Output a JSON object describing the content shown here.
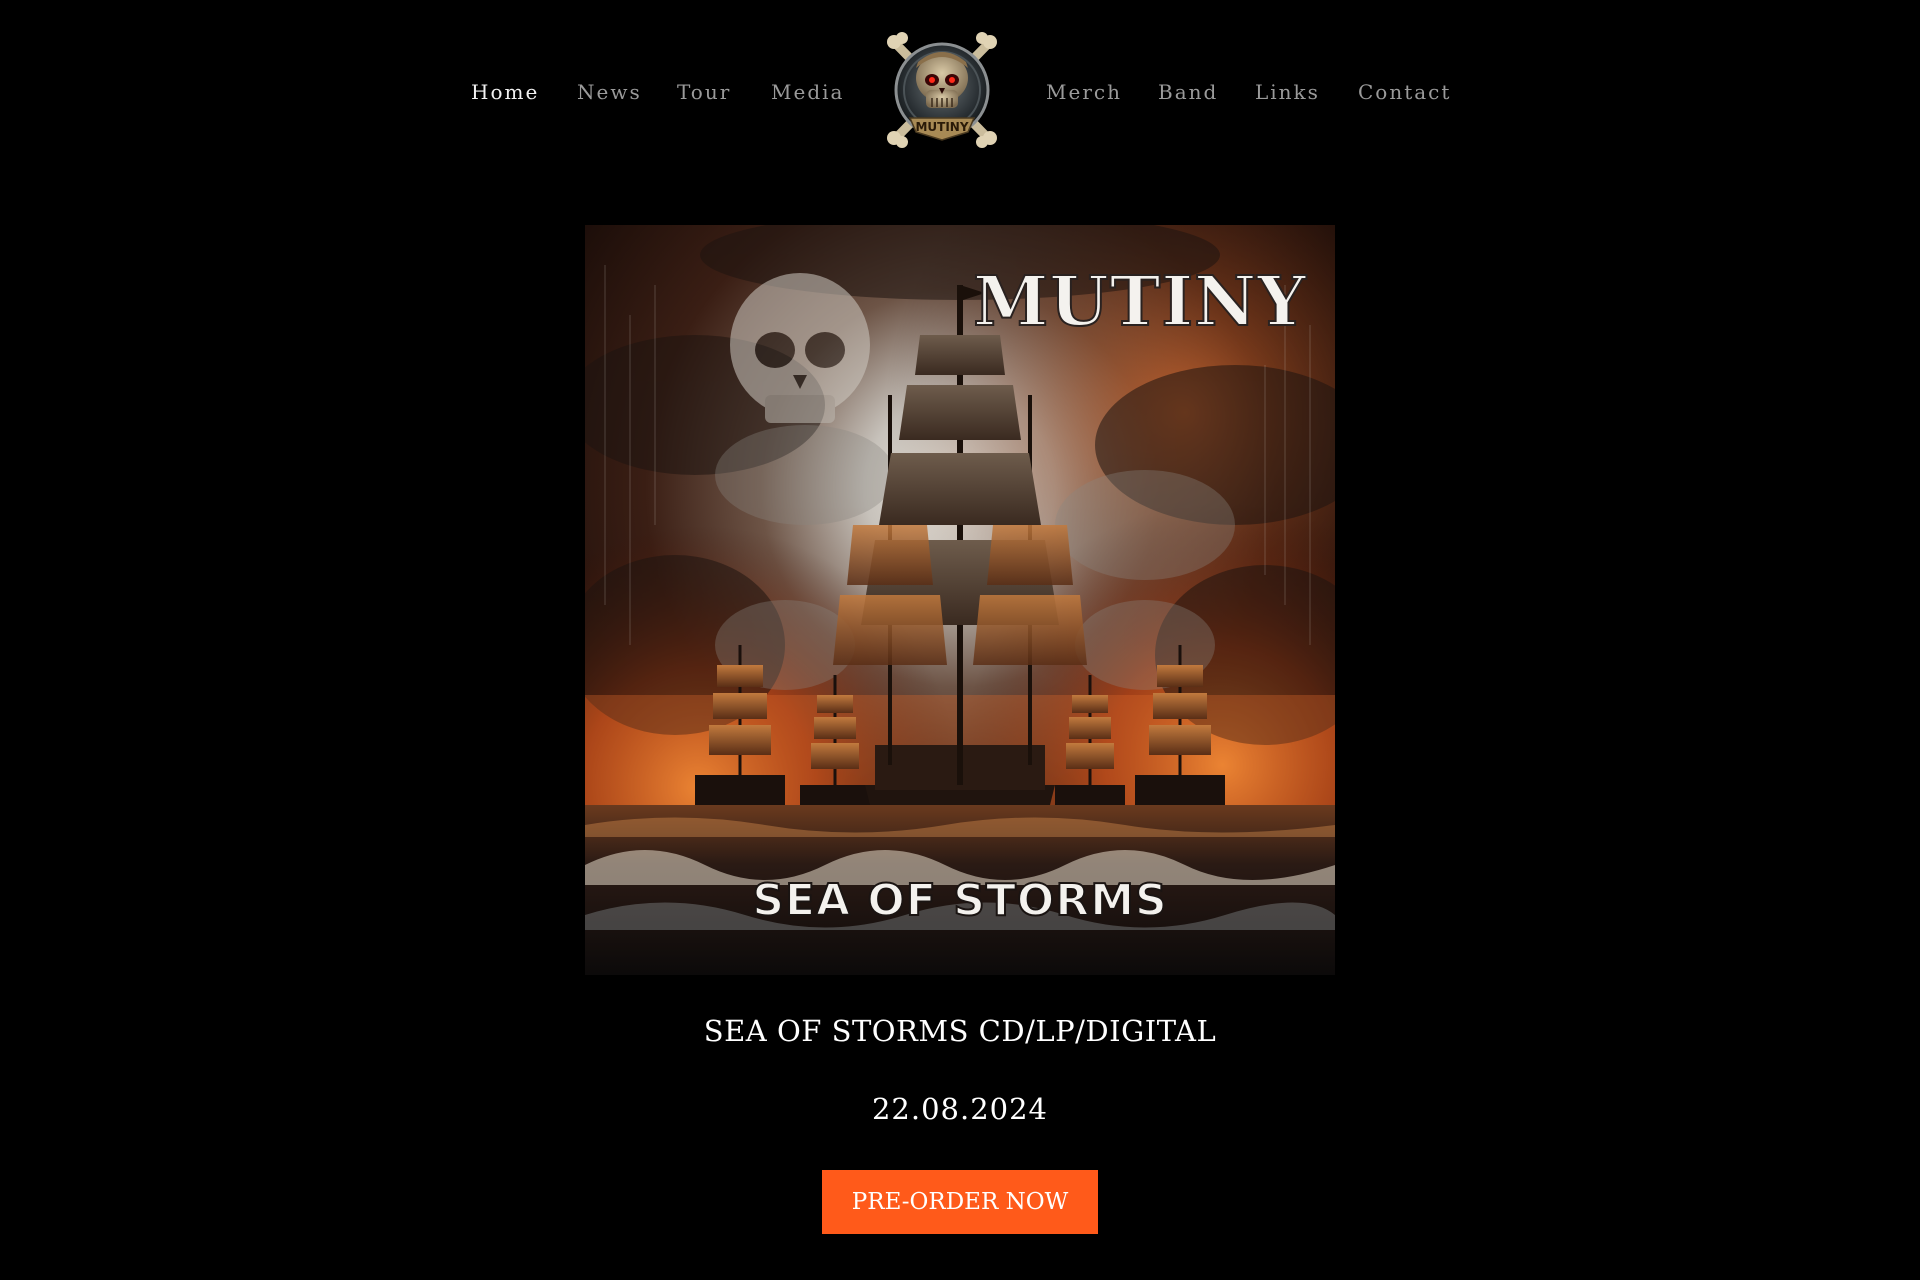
{
  "nav": {
    "items": [
      {
        "label": "Home",
        "active": true
      },
      {
        "label": "News"
      },
      {
        "label": "Tour"
      },
      {
        "label": "Media"
      },
      {
        "label": "Merch"
      },
      {
        "label": "Band"
      },
      {
        "label": "Links"
      },
      {
        "label": "Contact"
      }
    ],
    "logo_text": "MUTINY"
  },
  "cover": {
    "band_name": "MUTINY",
    "album_title": "SEA OF STORMS"
  },
  "release": {
    "title": "SEA OF STORMS CD/LP/DIGITAL",
    "date": "22.08.2024"
  },
  "cta": {
    "label": "PRE-ORDER NOW"
  },
  "colors": {
    "background": "#000000",
    "accent": "#ff5a1a",
    "nav_inactive": "#9a9a9a",
    "nav_active": "#f2f2f2"
  }
}
